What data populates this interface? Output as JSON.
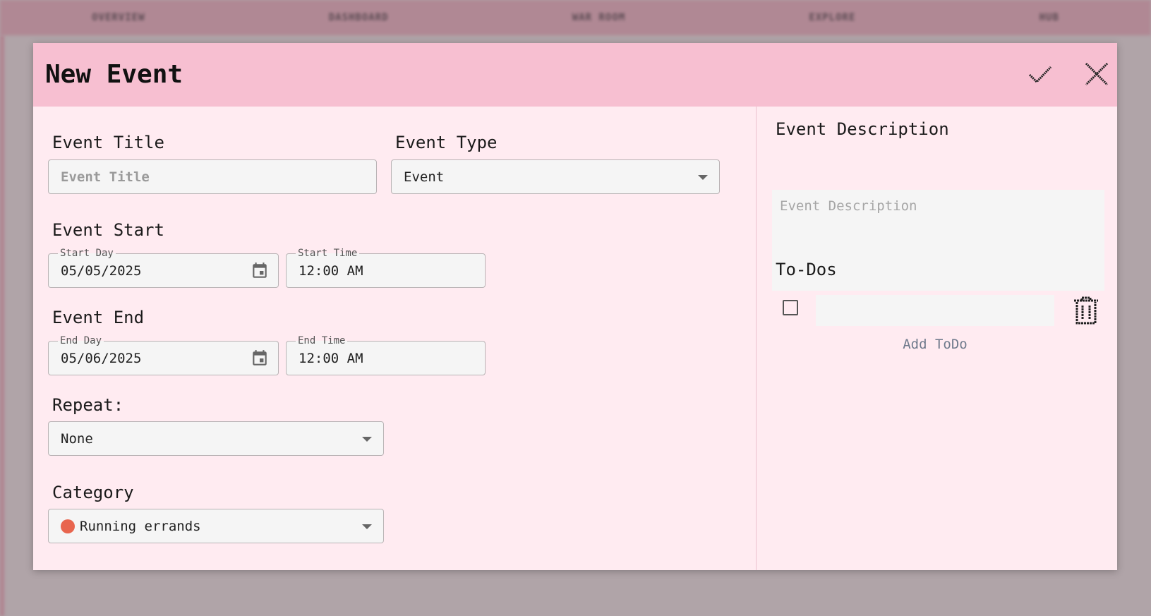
{
  "background_nav": {
    "items": [
      "OVERVIEW",
      "DASHBOARD",
      "WAR ROOM",
      "EXPLORE",
      "HUB"
    ]
  },
  "modal": {
    "title": "New Event",
    "confirm_icon": "check-icon",
    "close_icon": "close-icon"
  },
  "form": {
    "event_title": {
      "label": "Event Title",
      "placeholder": "Event Title",
      "value": ""
    },
    "event_type": {
      "label": "Event Type",
      "value": "Event"
    },
    "event_start": {
      "label": "Event Start",
      "day_label": "Start Day",
      "day_value": "05/05/2025",
      "time_label": "Start Time",
      "time_value": "12:00 AM"
    },
    "event_end": {
      "label": "Event End",
      "day_label": "End Day",
      "day_value": "05/06/2025",
      "time_label": "End Time",
      "time_value": "12:00 AM"
    },
    "repeat": {
      "label": "Repeat:",
      "value": "None"
    },
    "category": {
      "label": "Category",
      "value": "Running errands",
      "color": "#e8654e"
    }
  },
  "side": {
    "description": {
      "label": "Event Description",
      "placeholder": "Event Description"
    },
    "todos": {
      "label": "To-Dos",
      "add_label": "Add ToDo",
      "items": [
        {
          "checked": false,
          "text": ""
        }
      ]
    }
  },
  "colors": {
    "header": "#f7bfd1",
    "modal_bg": "#ffebf1",
    "field_bg": "#f5f5f5",
    "overlay": "#b0a4a8"
  }
}
